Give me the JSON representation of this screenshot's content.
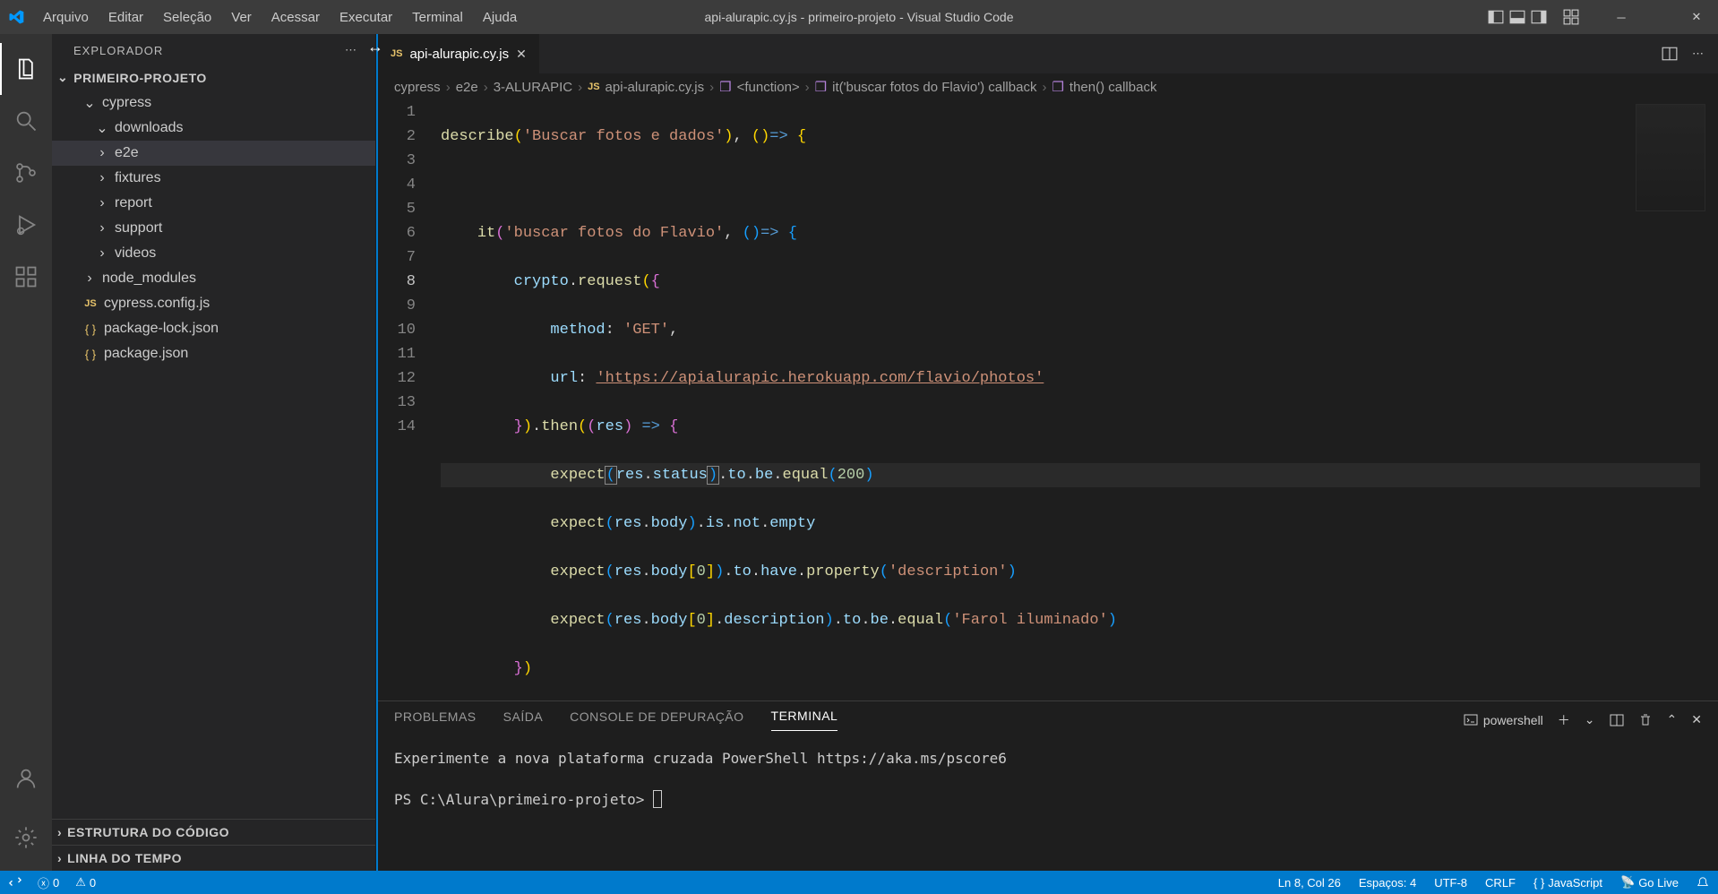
{
  "menu": [
    "Arquivo",
    "Editar",
    "Seleção",
    "Ver",
    "Acessar",
    "Executar",
    "Terminal",
    "Ajuda"
  ],
  "window_title": "api-alurapic.cy.js - primeiro-projeto - Visual Studio Code",
  "sidebar": {
    "title": "EXPLORADOR",
    "project": "PRIMEIRO-PROJETO",
    "tree": {
      "cypress": "cypress",
      "downloads": "downloads",
      "e2e": "e2e",
      "fixtures": "fixtures",
      "report": "report",
      "support": "support",
      "videos": "videos",
      "node_modules": "node_modules",
      "cypress_config": "cypress.config.js",
      "package_lock": "package-lock.json",
      "package_json": "package.json"
    },
    "outline": "ESTRUTURA DO CÓDIGO",
    "timeline": "LINHA DO TEMPO"
  },
  "tab": {
    "label": "api-alurapic.cy.js"
  },
  "breadcrumb": {
    "p1": "cypress",
    "p2": "e2e",
    "p3": "3-ALURAPIC",
    "p4": "api-alurapic.cy.js",
    "p5": "<function>",
    "p6": "it('buscar fotos do Flavio') callback",
    "p7": "then() callback"
  },
  "code": {
    "l1": {
      "describe": "describe",
      "s": "'Buscar fotos e dados'"
    },
    "l3": {
      "it": "it",
      "s": "'buscar fotos do Flavio'"
    },
    "l4": {
      "crypto": "crypto",
      "request": "request"
    },
    "l5": {
      "method": "method",
      "get": "'GET'"
    },
    "l6": {
      "url": "url",
      "val": "'https://apialurapic.herokuapp.com/flavio/photos'"
    },
    "l7": {
      "then": "then",
      "res": "res"
    },
    "l8": {
      "expect": "expect",
      "res": "res",
      "status": "status",
      "num": "200"
    },
    "l9": {
      "expect": "expect",
      "res": "res",
      "body": "body"
    },
    "l10": {
      "expect": "expect",
      "res": "res",
      "body": "body",
      "idx": "0",
      "desc": "'description'"
    },
    "l11": {
      "expect": "expect",
      "res": "res",
      "body": "body",
      "idx": "0",
      "description": "description",
      "val": "'Farol iluminado'"
    }
  },
  "line_numbers": [
    "1",
    "2",
    "3",
    "4",
    "5",
    "6",
    "7",
    "8",
    "9",
    "10",
    "11",
    "12",
    "13",
    "14"
  ],
  "panel": {
    "tabs": {
      "problems": "PROBLEMAS",
      "output": "SAÍDA",
      "debug": "CONSOLE DE DEPURAÇÃO",
      "terminal": "TERMINAL"
    },
    "shell": "powershell",
    "line1": "Experimente a nova plataforma cruzada PowerShell https://aka.ms/pscore6",
    "prompt": "PS C:\\Alura\\primeiro-projeto> "
  },
  "statusbar": {
    "errors": "0",
    "warnings": "0",
    "lncol": "Ln 8, Col 26",
    "spaces": "Espaços: 4",
    "encoding": "UTF-8",
    "eol": "CRLF",
    "lang": "JavaScript",
    "golive": "Go Live"
  }
}
